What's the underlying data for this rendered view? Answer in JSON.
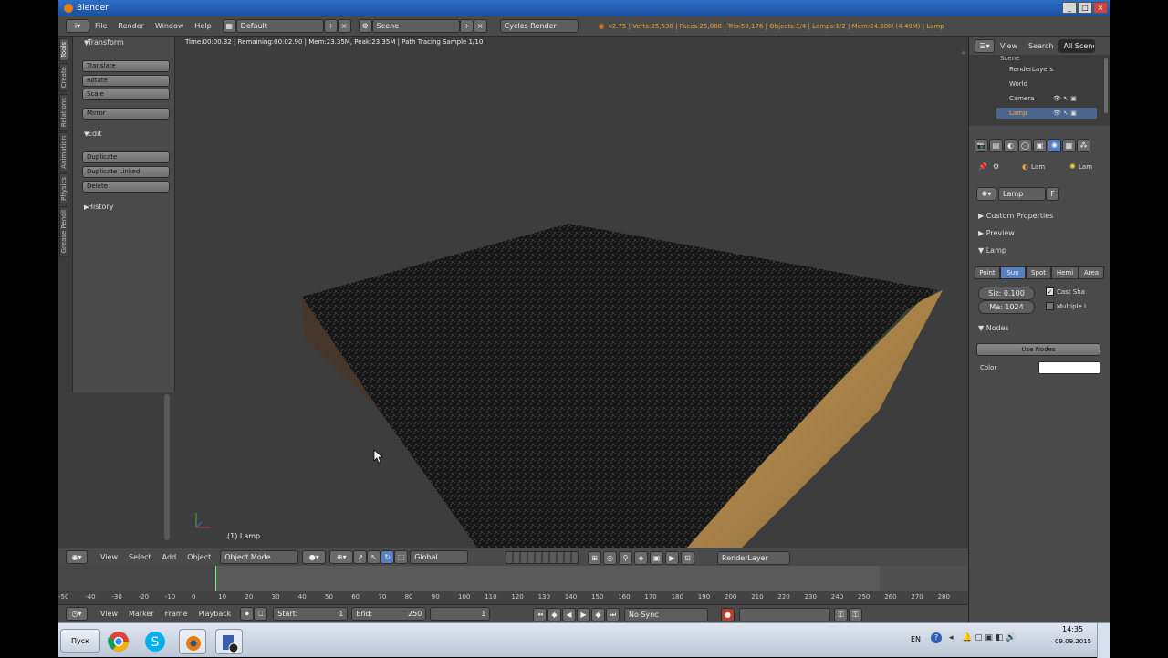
{
  "window": {
    "title": "Blender"
  },
  "info_header": {
    "menus": [
      "File",
      "Render",
      "Window",
      "Help"
    ],
    "screen_layout": "Default",
    "scene": "Scene",
    "render_engine": "Cycles Render",
    "stats": "v2.75 | Verts:25,538 | Faces:25,088 | Tris:50,176 | Objects:1/4 | Lamps:1/2 | Mem:24.68M (4.49M) | Lamp"
  },
  "tool_shelf": {
    "tabs": [
      "Tools",
      "Create",
      "Relations",
      "Animation",
      "Physics",
      "Grease Pencil"
    ],
    "transform": {
      "label": "Transform",
      "buttons": [
        "Translate",
        "Rotate",
        "Scale",
        "Mirror"
      ]
    },
    "edit": {
      "label": "Edit",
      "buttons": [
        "Duplicate",
        "Duplicate Linked",
        "Delete"
      ]
    },
    "history": {
      "label": "History"
    }
  },
  "viewport": {
    "render_info": "Time:00:00.32 | Remaining:00:02.90 | Mem:23.35M, Peak:23.35M | Path Tracing Sample 1/10",
    "object_label": "(1) Lamp"
  },
  "view3d_header": {
    "menus": [
      "View",
      "Select",
      "Add",
      "Object"
    ],
    "mode": "Object Mode",
    "orientation": "Global",
    "render_layer": "RenderLayer"
  },
  "timeline": {
    "ruler": [
      "-50",
      "-40",
      "-30",
      "-20",
      "-10",
      "0",
      "10",
      "20",
      "30",
      "40",
      "50",
      "60",
      "70",
      "80",
      "90",
      "100",
      "110",
      "120",
      "130",
      "140",
      "150",
      "160",
      "170",
      "180",
      "190",
      "200",
      "210",
      "220",
      "230",
      "240",
      "250",
      "260",
      "270",
      "280"
    ],
    "menus": [
      "View",
      "Marker",
      "Frame",
      "Playback"
    ],
    "start": "Start:",
    "start_value": "1",
    "end": "End:",
    "end_value": "250",
    "current_frame": "1",
    "sync": "No Sync"
  },
  "outliner": {
    "menus": [
      "View",
      "Search",
      "All Scenes"
    ],
    "items": [
      "Scene",
      "RenderLayers",
      "World",
      "Camera",
      "Lamp"
    ]
  },
  "properties": {
    "breadcrumb": [
      "Lam",
      "Lam"
    ],
    "datablock": "Lamp",
    "datablock_user": "F",
    "panels": {
      "custom": "Custom Properties",
      "preview": "Preview",
      "lamp": "Lamp",
      "nodes": "Nodes"
    },
    "lamp_types": [
      "Point",
      "Sun",
      "Spot",
      "Hemi",
      "Area"
    ],
    "active_lamp_type": "Sun",
    "size": "Siz: 0.100",
    "max_bounces": "Ma: 1024",
    "cast_shadow": "Cast Sha",
    "multiple_importance": "Multiple I",
    "use_nodes": "Use Nodes",
    "color_label": "Color",
    "color_value": "#ffffff"
  },
  "taskbar": {
    "start_label": "Пуск",
    "language": "EN",
    "time": "14:35",
    "date": "09.09.2015"
  },
  "colors": {
    "accent": "#5680c2",
    "stats": "#e6a33a",
    "titlebar": "#2d6fc7"
  }
}
